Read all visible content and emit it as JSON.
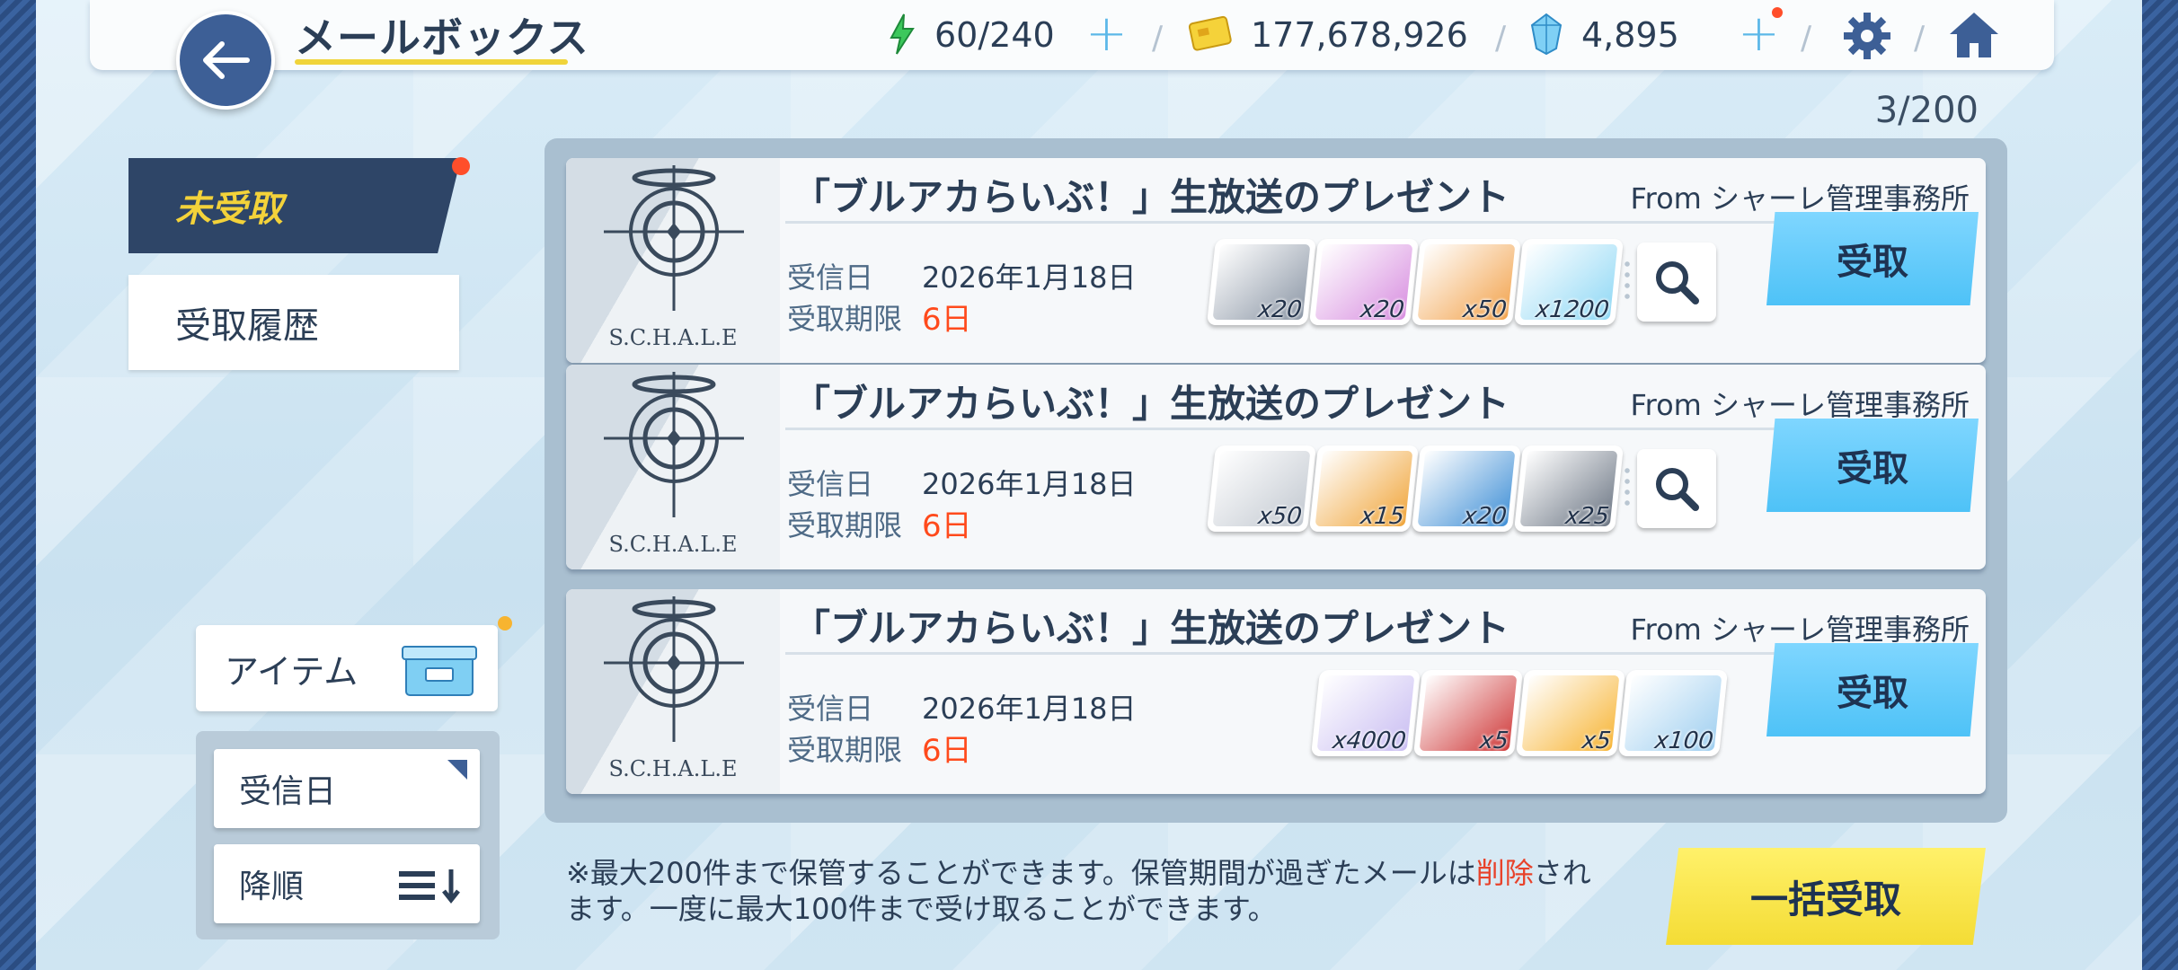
{
  "header": {
    "title": "メールボックス",
    "stamina": "60/240",
    "credits": "177,678,926",
    "pyroxene": "4,895"
  },
  "mail_count": "3/200",
  "tabs": [
    {
      "label": "未受取",
      "active": true
    },
    {
      "label": "受取履歴",
      "active": false
    }
  ],
  "filters": {
    "item_label": "アイテム",
    "sort_key": "受信日",
    "sort_order": "降順"
  },
  "mails": [
    {
      "subject": "「ブルアカらいぶ！」生放送のプレゼント",
      "from": "From シャーレ管理事務所",
      "received_label": "受信日",
      "received_value": "2026年1月18日",
      "deadline_label": "受取期限",
      "deadline_value": "6日",
      "logo_text": "S.C.H.A.L.E",
      "claim_label": "受取",
      "has_magnifier": true,
      "rewards": [
        {
          "icon": "ex-report-icon",
          "qty": "x20",
          "color": "#8c97a6"
        },
        {
          "icon": "pink-report-icon",
          "qty": "x20",
          "color": "#d88fe0"
        },
        {
          "icon": "orange-report-icon",
          "qty": "x50",
          "color": "#f2a34d"
        },
        {
          "icon": "pyroxene-crystal-icon",
          "qty": "x1200",
          "color": "#8fd8f5"
        }
      ]
    },
    {
      "subject": "「ブルアカらいぶ！」生放送のプレゼント",
      "from": "From シャーレ管理事務所",
      "received_label": "受信日",
      "received_value": "2026年1月18日",
      "deadline_label": "受取期限",
      "deadline_value": "6日",
      "logo_text": "S.C.H.A.L.E",
      "claim_label": "受取",
      "has_magnifier": true,
      "rewards": [
        {
          "icon": "silver-box-icon",
          "qty": "x50",
          "color": "#c3c9d1"
        },
        {
          "icon": "gold-ticket-icon",
          "qty": "x15",
          "color": "#f0a53a"
        },
        {
          "icon": "blue-ticket-icon",
          "qty": "x20",
          "color": "#3f8fd6"
        },
        {
          "icon": "gray-ticket-icon",
          "qty": "x25",
          "color": "#6c7684"
        }
      ]
    },
    {
      "subject": "「ブルアカらいぶ！」生放送のプレゼント",
      "from": "From シャーレ管理事務所",
      "received_label": "受信日",
      "received_value": "2026年1月18日",
      "deadline_label": "受取期限",
      "deadline_value": "6日",
      "logo_text": "S.C.H.A.L.E",
      "claim_label": "受取",
      "has_magnifier": false,
      "rewards": [
        {
          "icon": "coin-m-icon",
          "qty": "x4000",
          "color": "#c9bdf2"
        },
        {
          "icon": "rose-bouquet-icon",
          "qty": "x5",
          "color": "#cf3a3a"
        },
        {
          "icon": "gift-box-icon",
          "qty": "x5",
          "color": "#f7b536"
        },
        {
          "icon": "phone-card-icon",
          "qty": "x100",
          "color": "#9fcff0"
        }
      ]
    }
  ],
  "notice": {
    "part1": "※最大200件まで保管することができます。保管期間が過ぎたメールは",
    "red": "削除",
    "part2": "されます。一度に最大100件まで受け取ることができます。"
  },
  "claim_all_label": "一括受取"
}
